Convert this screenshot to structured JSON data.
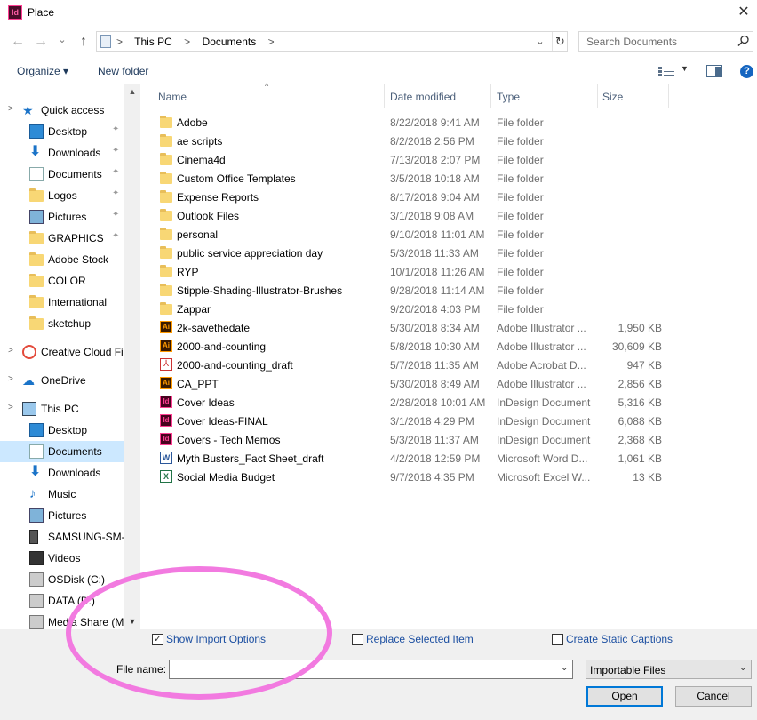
{
  "window": {
    "title": "Place",
    "app_icon": "indesign-app-icon",
    "close_glyph": "✕"
  },
  "nav": {
    "back_glyph": "←",
    "forward_glyph": "→",
    "recent_glyph": "⌄",
    "up_glyph": "↑",
    "breadcrumbs": [
      "This PC",
      "Documents"
    ],
    "crumb_separator": ">",
    "search_placeholder": "Search Documents"
  },
  "toolbar": {
    "organize_label": "Organize ▾",
    "new_folder_label": "New folder",
    "view_caret": "▼",
    "help_label": "?"
  },
  "sidebar": {
    "items": [
      {
        "label": "Quick access",
        "kind": "root",
        "icon": "star-icon",
        "pinned": false
      },
      {
        "label": "Desktop",
        "kind": "child",
        "icon": "desktop-icon",
        "pinned": true
      },
      {
        "label": "Downloads",
        "kind": "child",
        "icon": "download-icon",
        "pinned": true
      },
      {
        "label": "Documents",
        "kind": "child",
        "icon": "documents-icon",
        "pinned": true
      },
      {
        "label": "Logos",
        "kind": "child",
        "icon": "folder-icon",
        "pinned": true
      },
      {
        "label": "Pictures",
        "kind": "child",
        "icon": "pictures-icon",
        "pinned": true
      },
      {
        "label": "GRAPHICS",
        "kind": "child",
        "icon": "folder-icon",
        "pinned": true
      },
      {
        "label": "Adobe Stock",
        "kind": "child",
        "icon": "folder-icon",
        "pinned": false
      },
      {
        "label": "COLOR",
        "kind": "child",
        "icon": "folder-icon",
        "pinned": false
      },
      {
        "label": "International",
        "kind": "child",
        "icon": "folder-icon",
        "pinned": false
      },
      {
        "label": "sketchup",
        "kind": "child",
        "icon": "folder-icon",
        "pinned": false
      },
      {
        "label": "Creative Cloud Fil",
        "kind": "root",
        "icon": "creative-cloud-icon",
        "pinned": false
      },
      {
        "label": "OneDrive",
        "kind": "root",
        "icon": "onedrive-icon",
        "pinned": false
      },
      {
        "label": "This PC",
        "kind": "root",
        "icon": "this-pc-icon",
        "pinned": false
      },
      {
        "label": "Desktop",
        "kind": "child",
        "icon": "desktop-icon",
        "pinned": false
      },
      {
        "label": "Documents",
        "kind": "child",
        "icon": "documents-icon",
        "pinned": false,
        "selected": true
      },
      {
        "label": "Downloads",
        "kind": "child",
        "icon": "download-icon",
        "pinned": false
      },
      {
        "label": "Music",
        "kind": "child",
        "icon": "music-icon",
        "pinned": false
      },
      {
        "label": "Pictures",
        "kind": "child",
        "icon": "pictures-icon",
        "pinned": false
      },
      {
        "label": "SAMSUNG-SM-G",
        "kind": "child",
        "icon": "phone-icon",
        "pinned": false
      },
      {
        "label": "Videos",
        "kind": "child",
        "icon": "videos-icon",
        "pinned": false
      },
      {
        "label": "OSDisk (C:)",
        "kind": "child",
        "icon": "drive-icon",
        "pinned": false
      },
      {
        "label": "DATA (D:)",
        "kind": "child",
        "icon": "drive-icon",
        "pinned": false
      },
      {
        "label": "Media Share (M:",
        "kind": "child",
        "icon": "network-drive-icon",
        "pinned": false
      }
    ],
    "pin_glyph": "📌",
    "chevron_glyph": ">"
  },
  "columns": {
    "name": "Name",
    "date": "Date modified",
    "type": "Type",
    "size": "Size"
  },
  "files": [
    {
      "name": "Adobe",
      "date": "8/22/2018 9:41 AM",
      "type": "File folder",
      "size": "",
      "icon": "folder"
    },
    {
      "name": "ae scripts",
      "date": "8/2/2018 2:56 PM",
      "type": "File folder",
      "size": "",
      "icon": "folder"
    },
    {
      "name": "Cinema4d",
      "date": "7/13/2018 2:07 PM",
      "type": "File folder",
      "size": "",
      "icon": "folder"
    },
    {
      "name": "Custom Office Templates",
      "date": "3/5/2018 10:18 AM",
      "type": "File folder",
      "size": "",
      "icon": "folder"
    },
    {
      "name": "Expense Reports",
      "date": "8/17/2018 9:04 AM",
      "type": "File folder",
      "size": "",
      "icon": "folder"
    },
    {
      "name": "Outlook Files",
      "date": "3/1/2018 9:08 AM",
      "type": "File folder",
      "size": "",
      "icon": "folder"
    },
    {
      "name": "personal",
      "date": "9/10/2018 11:01 AM",
      "type": "File folder",
      "size": "",
      "icon": "folder"
    },
    {
      "name": "public service appreciation day",
      "date": "5/3/2018 11:33 AM",
      "type": "File folder",
      "size": "",
      "icon": "folder"
    },
    {
      "name": "RYP",
      "date": "10/1/2018 11:26 AM",
      "type": "File folder",
      "size": "",
      "icon": "folder"
    },
    {
      "name": "Stipple-Shading-Illustrator-Brushes",
      "date": "9/28/2018 11:14 AM",
      "type": "File folder",
      "size": "",
      "icon": "folder"
    },
    {
      "name": "Zappar",
      "date": "9/20/2018 4:03 PM",
      "type": "File folder",
      "size": "",
      "icon": "folder"
    },
    {
      "name": "2k-savethedate",
      "date": "5/30/2018 8:34 AM",
      "type": "Adobe Illustrator ...",
      "size": "1,950 KB",
      "icon": "illustrator"
    },
    {
      "name": "2000-and-counting",
      "date": "5/8/2018 10:30 AM",
      "type": "Adobe Illustrator ...",
      "size": "30,609 KB",
      "icon": "illustrator"
    },
    {
      "name": "2000-and-counting_draft",
      "date": "5/7/2018 11:35 AM",
      "type": "Adobe Acrobat D...",
      "size": "947 KB",
      "icon": "pdf"
    },
    {
      "name": "CA_PPT",
      "date": "5/30/2018 8:49 AM",
      "type": "Adobe Illustrator ...",
      "size": "2,856 KB",
      "icon": "illustrator"
    },
    {
      "name": "Cover Ideas",
      "date": "2/28/2018 10:01 AM",
      "type": "InDesign Document",
      "size": "5,316 KB",
      "icon": "indesign"
    },
    {
      "name": "Cover Ideas-FINAL",
      "date": "3/1/2018 4:29 PM",
      "type": "InDesign Document",
      "size": "6,088 KB",
      "icon": "indesign"
    },
    {
      "name": "Covers - Tech Memos",
      "date": "5/3/2018 11:37 AM",
      "type": "InDesign Document",
      "size": "2,368 KB",
      "icon": "indesign"
    },
    {
      "name": "Myth Busters_Fact Sheet_draft",
      "date": "4/2/2018 12:59 PM",
      "type": "Microsoft Word D...",
      "size": "1,061 KB",
      "icon": "word"
    },
    {
      "name": "Social Media Budget",
      "date": "9/7/2018 4:35 PM",
      "type": "Microsoft Excel W...",
      "size": "13 KB",
      "icon": "excel"
    }
  ],
  "options": {
    "show_import_options": {
      "label": "Show Import Options",
      "checked": true
    },
    "replace_selected_item": {
      "label": "Replace Selected Item",
      "checked": false
    },
    "create_static_captions": {
      "label": "Create Static Captions",
      "checked": false
    }
  },
  "file_name": {
    "label": "File name:",
    "value": ""
  },
  "file_type_filter": {
    "selected": "Importable Files"
  },
  "buttons": {
    "open": "Open",
    "cancel": "Cancel"
  },
  "colors": {
    "accent": "#0078d7",
    "selection": "#cce8ff",
    "annotation": "#f27ae0",
    "link_text": "#1c4fa1"
  }
}
